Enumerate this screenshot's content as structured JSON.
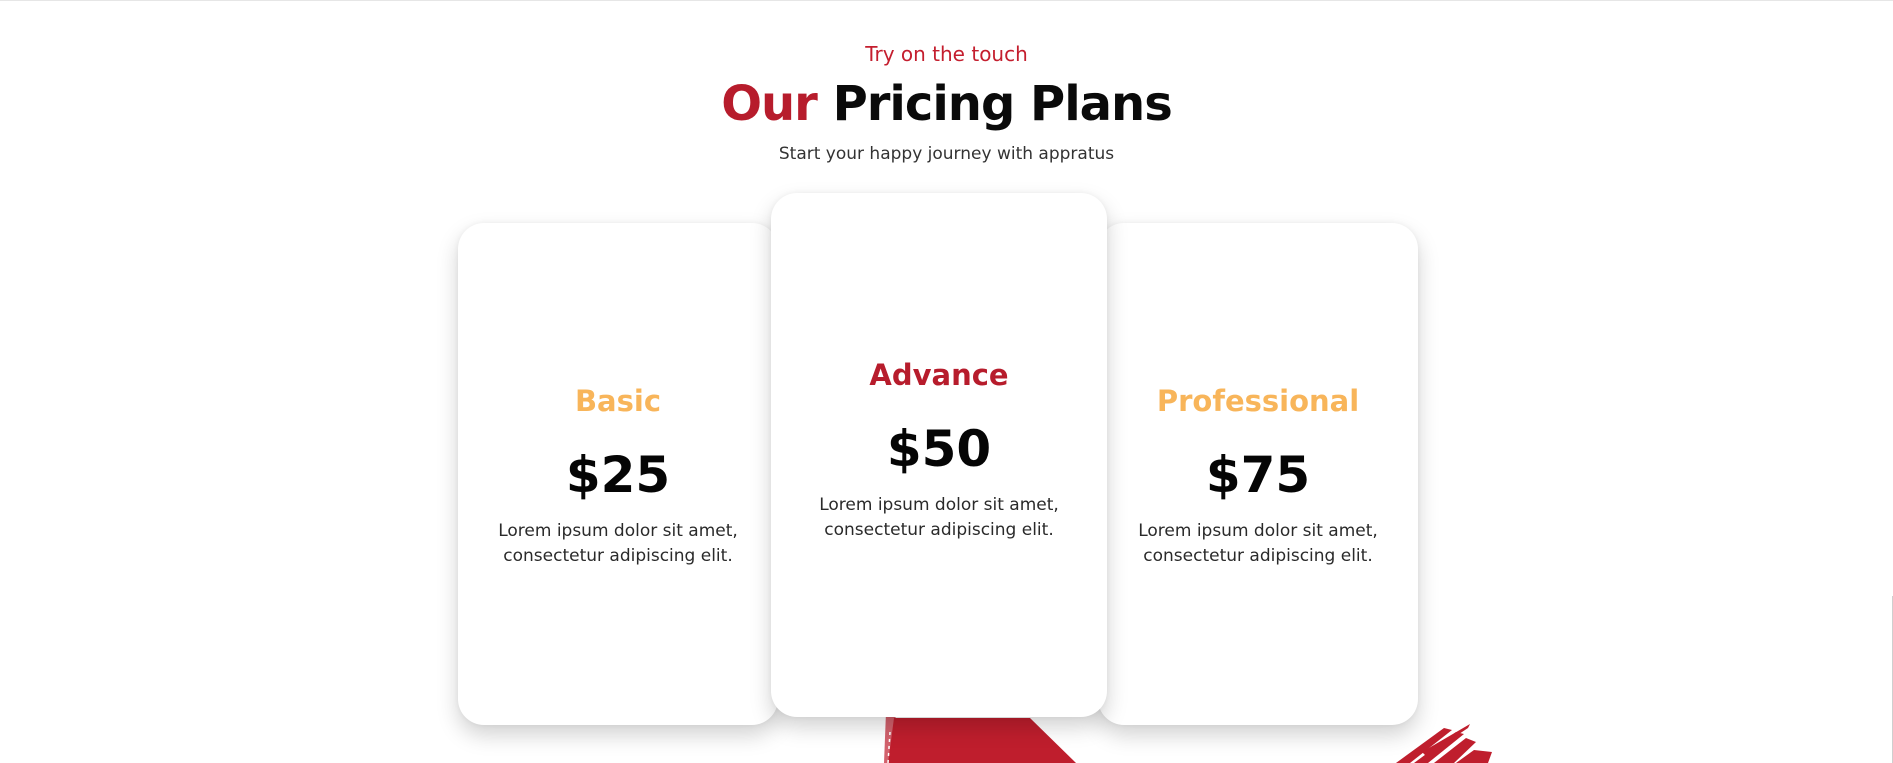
{
  "section": {
    "eyebrow": "Try on the touch",
    "title_accent": "Our",
    "title_rest": "Pricing Plans",
    "subtitle": "Start your happy journey with appratus"
  },
  "plans": [
    {
      "name": "Basic",
      "price": "$25",
      "description_line1": "Lorem ipsum dolor sit amet,",
      "description_line2": "consectetur adipiscing elit.",
      "name_color": "#f8b55a"
    },
    {
      "name": "Advance",
      "price": "$50",
      "description_line1": "Lorem ipsum dolor sit amet,",
      "description_line2": "consectetur adipiscing elit.",
      "name_color": "#b71c2c"
    },
    {
      "name": "Professional",
      "price": "$75",
      "description_line1": "Lorem ipsum dolor sit amet,",
      "description_line2": "consectetur adipiscing elit.",
      "name_color": "#f8b55a"
    }
  ],
  "colors": {
    "accent_red": "#b71c2c",
    "accent_gold": "#f8b55a",
    "text_dark": "#0a0a0a",
    "background": "#ffffff"
  },
  "decorations": [
    "red-brush-stroke-shape",
    "red-brush-splash-shape"
  ]
}
